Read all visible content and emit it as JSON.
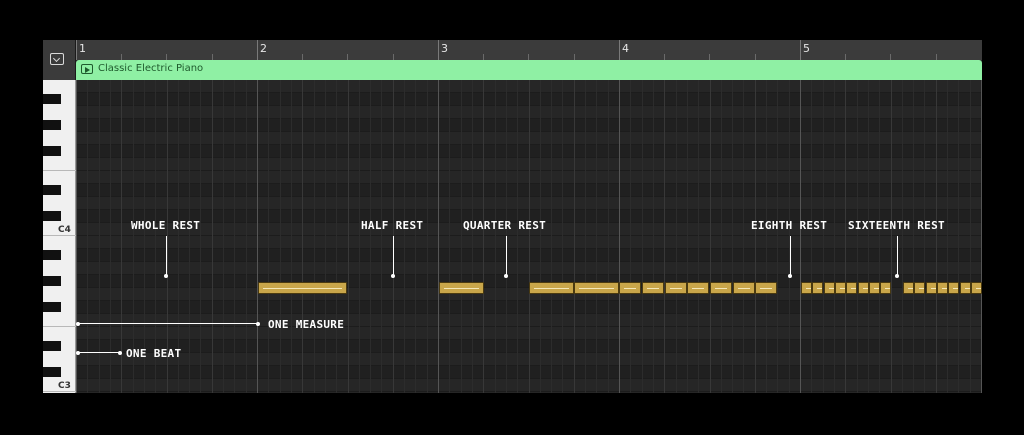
{
  "ruler": {
    "bars": [
      "1",
      "2",
      "3",
      "4",
      "5"
    ]
  },
  "region": {
    "name": "Classic Electric Piano",
    "color": "#8ff0a4"
  },
  "keyboard": {
    "labels": [
      "C4",
      "C3"
    ]
  },
  "notes": {
    "color": "#c9a64a"
  },
  "annotations": {
    "whole_rest": "WHOLE REST",
    "half_rest": "HALF REST",
    "quarter_rest": "QUARTER REST",
    "eighth_rest": "EIGHTH REST",
    "sixteenth_rest": "SIXTEENTH REST",
    "one_measure": "ONE MEASURE",
    "one_beat": "ONE BEAT"
  }
}
